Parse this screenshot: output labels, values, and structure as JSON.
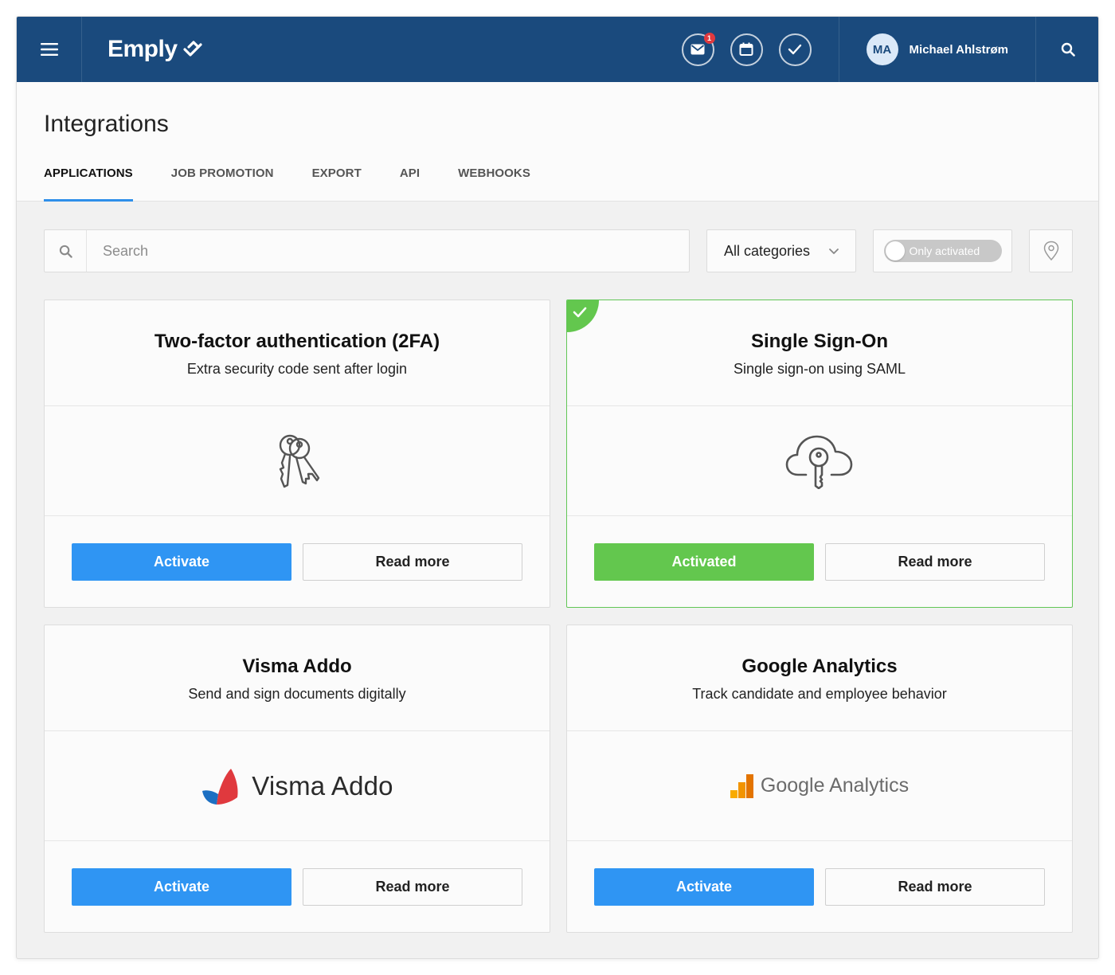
{
  "topbar": {
    "brand": "Emply",
    "notification_count": "1",
    "user_initials": "MA",
    "user_name": "Michael Ahlstrøm",
    "icons": [
      "menu-icon",
      "mail-icon",
      "calendar-icon",
      "check-icon",
      "search-icon"
    ]
  },
  "page": {
    "title": "Integrations",
    "tabs": [
      {
        "label": "APPLICATIONS",
        "active": true
      },
      {
        "label": "JOB PROMOTION",
        "active": false
      },
      {
        "label": "EXPORT",
        "active": false
      },
      {
        "label": "API",
        "active": false
      },
      {
        "label": "WEBHOOKS",
        "active": false
      }
    ]
  },
  "filters": {
    "search_placeholder": "Search",
    "category": "All categories",
    "toggle_label": "Only activated",
    "toggle_on": false
  },
  "cards": [
    {
      "title": "Two-factor authentication (2FA)",
      "description": "Extra security code sent after login",
      "activated": false,
      "primary_label": "Activate",
      "secondary_label": "Read more",
      "icon": "keys-icon"
    },
    {
      "title": "Single Sign-On",
      "description": "Single sign-on using SAML",
      "activated": true,
      "primary_label": "Activated",
      "secondary_label": "Read more",
      "icon": "cloud-key-icon"
    },
    {
      "title": "Visma Addo",
      "description": "Send and sign documents digitally",
      "activated": false,
      "primary_label": "Activate",
      "secondary_label": "Read more",
      "logo_text": "Visma Addo"
    },
    {
      "title": "Google Analytics",
      "description": "Track candidate and employee behavior",
      "activated": false,
      "primary_label": "Activate",
      "secondary_label": "Read more",
      "logo_text": "Google Analytics"
    }
  ],
  "colors": {
    "topbar": "#1a4a7d",
    "primary": "#2f95f3",
    "success": "#63c74e",
    "tab_underline": "#2f8fea",
    "badge": "#e0393e"
  }
}
